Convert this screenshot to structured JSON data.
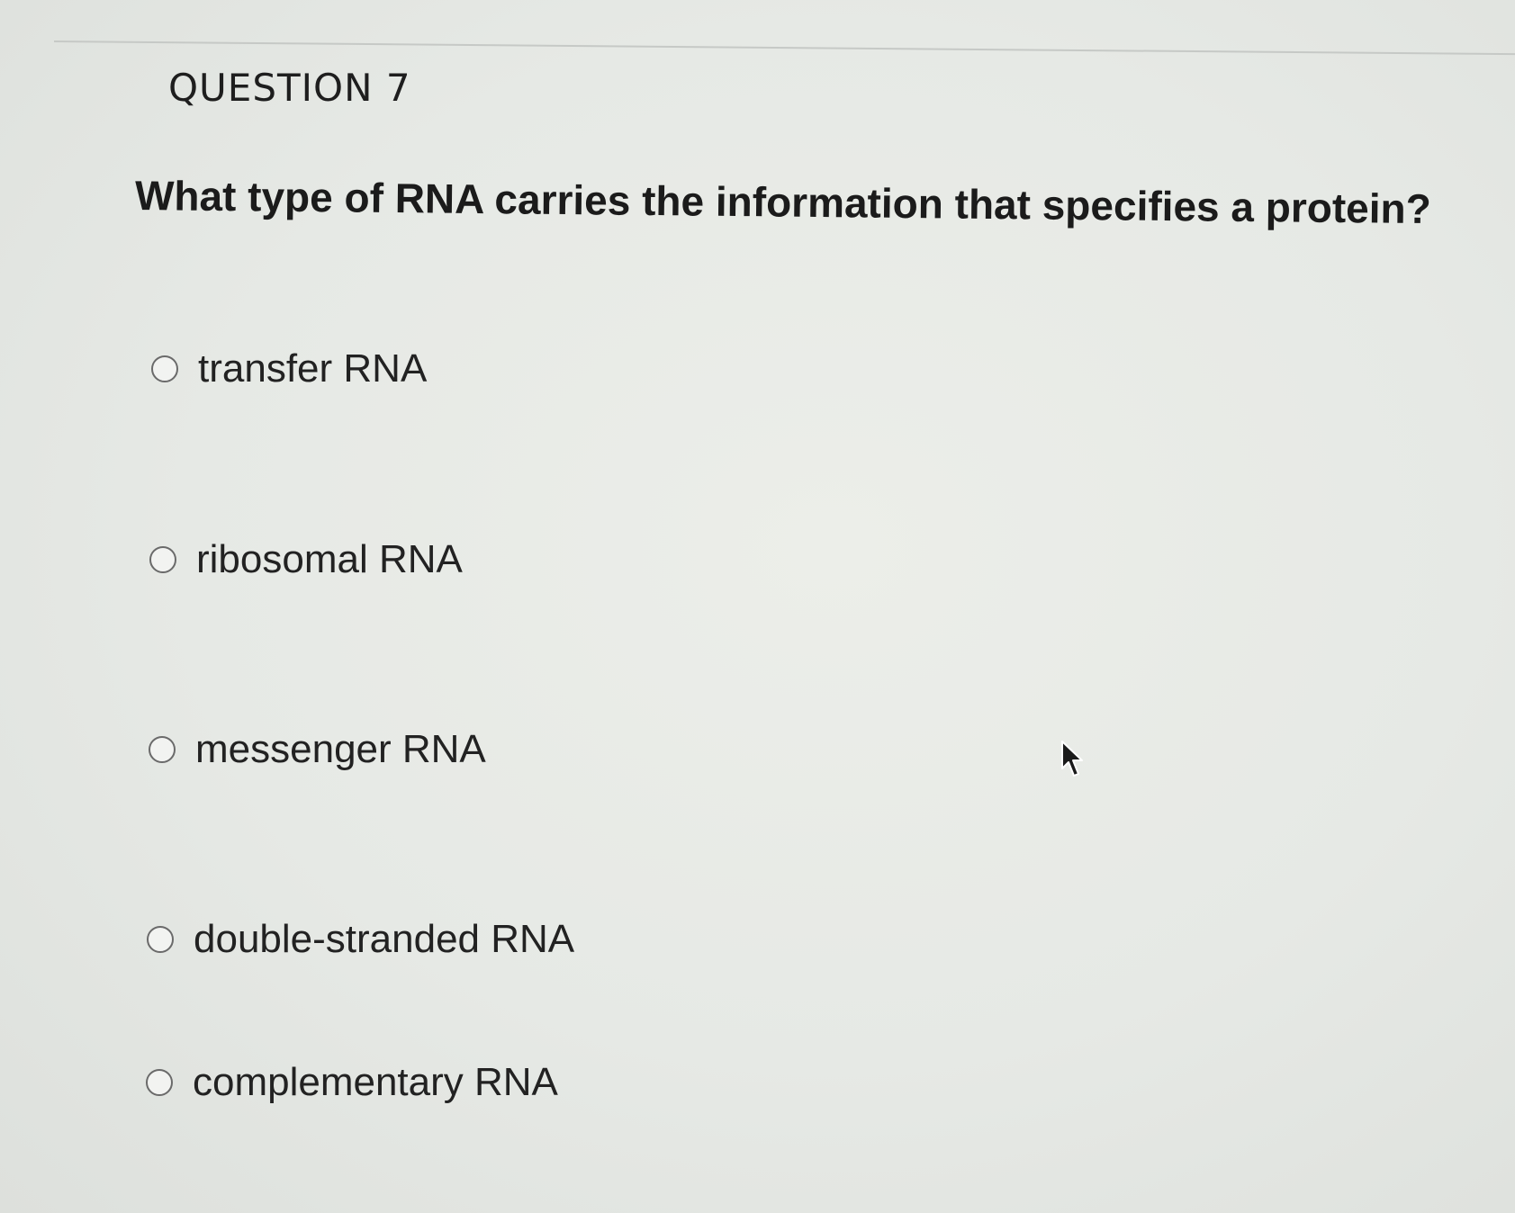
{
  "question": {
    "number_label": "QUESTION 7",
    "text": "What type of RNA carries the information that specifies a protein?"
  },
  "options": [
    {
      "label": "transfer RNA",
      "selected": false
    },
    {
      "label": "ribosomal RNA",
      "selected": false
    },
    {
      "label": "messenger RNA",
      "selected": false
    },
    {
      "label": "double-stranded RNA",
      "selected": false
    },
    {
      "label": "complementary RNA",
      "selected": false
    }
  ],
  "icons": {
    "radio": "radio-unchecked-icon",
    "cursor": "mouse-pointer-icon"
  }
}
